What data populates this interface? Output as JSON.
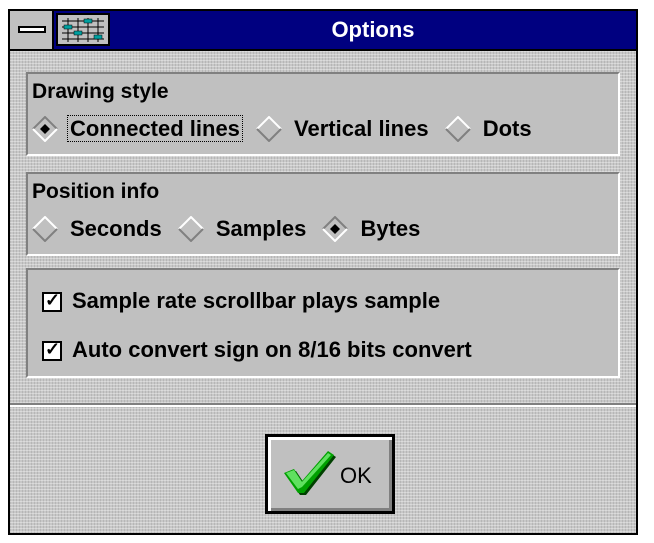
{
  "window": {
    "title": "Options",
    "system_menu_icon": "minus-bar-icon",
    "app_icon": "equalizer-icon"
  },
  "drawing_style": {
    "title": "Drawing style",
    "options": [
      {
        "label": "Connected lines",
        "selected": true
      },
      {
        "label": "Vertical lines",
        "selected": false
      },
      {
        "label": "Dots",
        "selected": false
      }
    ]
  },
  "position_info": {
    "title": "Position info",
    "options": [
      {
        "label": "Seconds",
        "selected": false
      },
      {
        "label": "Samples",
        "selected": false
      },
      {
        "label": "Bytes",
        "selected": true
      }
    ]
  },
  "checkboxes": [
    {
      "label": "Sample rate scrollbar plays sample",
      "checked": true
    },
    {
      "label": "Auto convert sign on 8/16 bits convert",
      "checked": true
    }
  ],
  "checkmark_glyph": "✓",
  "ok_button": {
    "label": "OK",
    "icon": "green-checkmark-icon"
  },
  "colors": {
    "title_bar": "#000080",
    "face": "#c0c0c0",
    "check_green": "#00a000"
  }
}
